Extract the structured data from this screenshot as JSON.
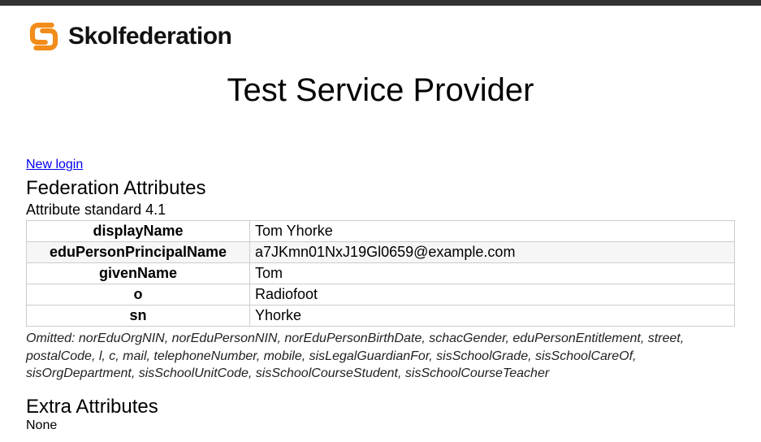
{
  "brand": "Skolfederation",
  "pageTitle": "Test Service Provider",
  "newLogin": "New login",
  "fedHeading": "Federation Attributes",
  "attrStandard": "Attribute standard 4.1",
  "rows": [
    {
      "k": "displayName",
      "v": "Tom Yhorke"
    },
    {
      "k": "eduPersonPrincipalName",
      "v": "a7JKmn01NxJ19Gl0659@example.com"
    },
    {
      "k": "givenName",
      "v": "Tom"
    },
    {
      "k": "o",
      "v": "Radiofoot"
    },
    {
      "k": "sn",
      "v": "Yhorke"
    }
  ],
  "omitted": "Omitted: norEduOrgNIN, norEduPersonNIN, norEduPersonBirthDate, schacGender, eduPersonEntitlement, street, postalCode, l, c, mail, telephoneNumber, mobile, sisLegalGuardianFor, sisSchoolGrade, sisSchoolCareOf, sisOrgDepartment, sisSchoolUnitCode, sisSchoolCourseStudent, sisSchoolCourseTeacher",
  "extraHeading": "Extra Attributes",
  "extraValue": "None"
}
